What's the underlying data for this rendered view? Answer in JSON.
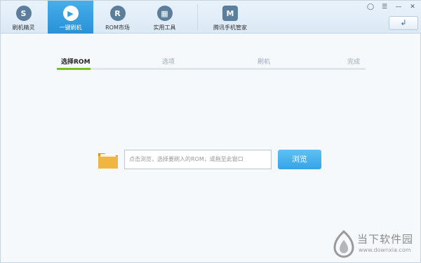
{
  "toolbar": {
    "items": [
      {
        "label": "刷机精灵",
        "icon": "S"
      },
      {
        "label": "一键刷机",
        "icon": "▶"
      },
      {
        "label": "ROM市场",
        "icon": "R"
      },
      {
        "label": "实用工具",
        "icon": "▦"
      },
      {
        "label": "腾讯手机管家",
        "icon": "M"
      }
    ],
    "active_index": 1
  },
  "window_controls": {
    "feedback": "◯",
    "menu": "☰",
    "minimize": "—",
    "close": "✕"
  },
  "back_button": "↲",
  "steps": {
    "items": [
      "选择ROM",
      "选项",
      "刷机",
      "完成"
    ],
    "active_index": 0
  },
  "file_select": {
    "placeholder": "点击浏览，选择要刷入的ROM，或拖至此窗口",
    "browse_label": "浏览"
  },
  "watermark": {
    "title": "当下软件园",
    "url": "www.downxia.com"
  },
  "colors": {
    "accent": "#2fa0e0",
    "progress": "#77c11e",
    "folder": "#f1b642"
  }
}
